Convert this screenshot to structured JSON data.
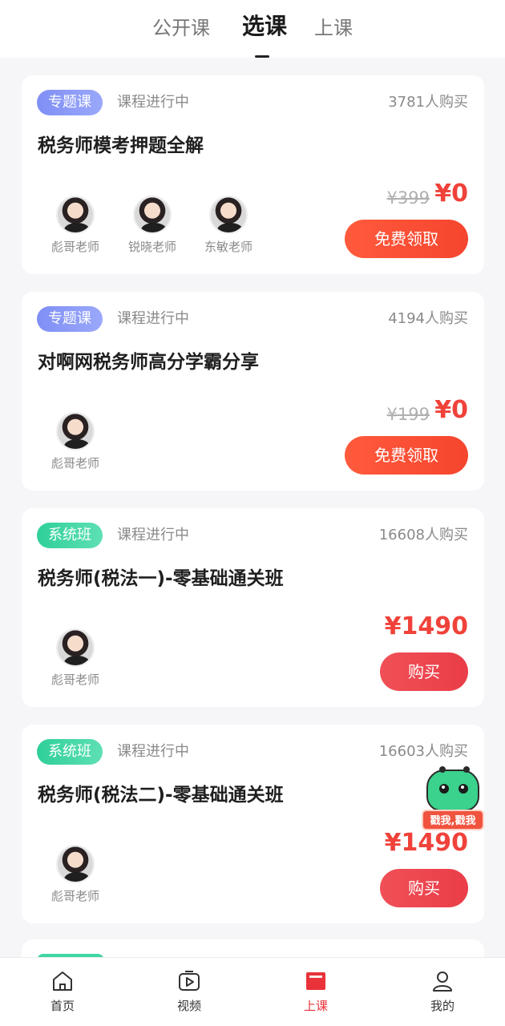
{
  "tabs": [
    {
      "label": "公开课"
    },
    {
      "label": "选课"
    },
    {
      "label": "上课"
    }
  ],
  "active_tab": "选课",
  "courses": [
    {
      "tag": "专题课",
      "status": "课程进行中",
      "buyers": "3781人购买",
      "title": "税务师模考押题全解",
      "teachers": [
        "彪哥老师",
        "锐晓老师",
        "东敏老师"
      ],
      "old_price": "¥399",
      "price": "¥0",
      "button": "免费领取"
    },
    {
      "tag": "专题课",
      "status": "课程进行中",
      "buyers": "4194人购买",
      "title": "对啊网税务师高分学霸分享",
      "teachers": [
        "彪哥老师"
      ],
      "old_price": "¥199",
      "price": "¥0",
      "button": "免费领取"
    },
    {
      "tag": "系统班",
      "status": "课程进行中",
      "buyers": "16608人购买",
      "title": "税务师(税法一)-零基础通关班",
      "teachers": [
        "彪哥老师"
      ],
      "price": "¥1490",
      "button": "购买"
    },
    {
      "tag": "系统班",
      "status": "课程进行中",
      "buyers": "16603人购买",
      "title": "税务师(税法二)-零基础通关班",
      "teachers": [
        "彪哥老师"
      ],
      "price": "¥1490",
      "button": "购买"
    }
  ],
  "mascot_label": "戳我,戳我",
  "bottom_nav": [
    {
      "label": "首页",
      "icon": "home-icon"
    },
    {
      "label": "视频",
      "icon": "video-icon"
    },
    {
      "label": "上课",
      "icon": "class-icon"
    },
    {
      "label": "我的",
      "icon": "profile-icon"
    }
  ],
  "colors": {
    "accent_red": "#f0423a",
    "topic_tag": "#8a9af8",
    "system_tag": "#3fd6a2"
  }
}
